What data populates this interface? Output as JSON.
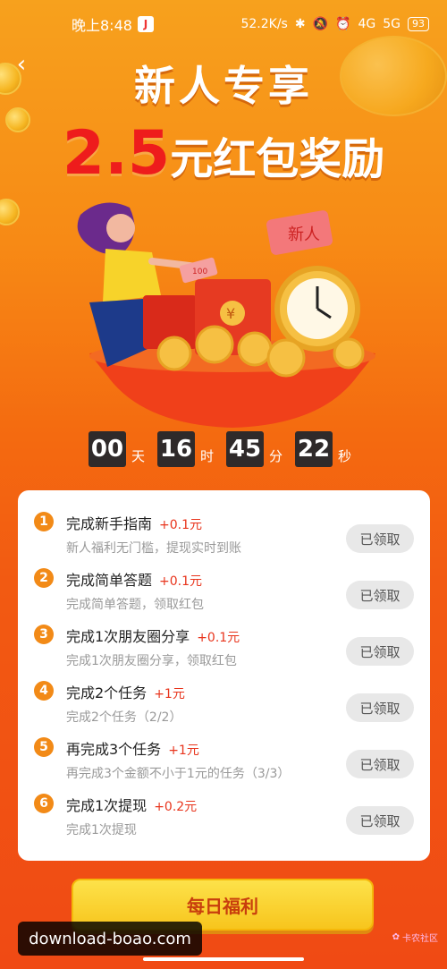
{
  "status_bar": {
    "time": "晚上8:48",
    "app_badge": "J",
    "speed": "52.2K/s",
    "net1": "4G",
    "net2": "5G",
    "battery": "93"
  },
  "hero": {
    "title": "新人专享",
    "amount": "2.5",
    "subtitle": "元红包奖励",
    "illustration_tag": "新人",
    "money_tag": "100",
    "yen_symbol": "¥"
  },
  "countdown": {
    "days": "00",
    "days_unit": "天",
    "hours": "16",
    "hours_unit": "时",
    "minutes": "45",
    "minutes_unit": "分",
    "seconds": "22",
    "seconds_unit": "秒"
  },
  "tasks": [
    {
      "num": "1",
      "title": "完成新手指南",
      "reward": "+0.1元",
      "desc": "新人福利无门槛，提现实时到账",
      "button": "已领取"
    },
    {
      "num": "2",
      "title": "完成简单答题",
      "reward": "+0.1元",
      "desc": "完成简单答题，领取红包",
      "button": "已领取"
    },
    {
      "num": "3",
      "title": "完成1次朋友圈分享",
      "reward": "+0.1元",
      "desc": "完成1次朋友圈分享，领取红包",
      "button": "已领取"
    },
    {
      "num": "4",
      "title": "完成2个任务",
      "reward": "+1元",
      "desc": "完成2个任务（2/2）",
      "button": "已领取"
    },
    {
      "num": "5",
      "title": "再完成3个任务",
      "reward": "+1元",
      "desc": "再完成3个金额不小于1元的任务（3/3）",
      "button": "已领取"
    },
    {
      "num": "6",
      "title": "完成1次提现",
      "reward": "+0.2元",
      "desc": "完成1次提现",
      "button": "已领取"
    }
  ],
  "daily_button": "每日福利",
  "watermark": "download-boao.com",
  "site_badge": "卡农社区",
  "colors": {
    "accent": "#f28a17",
    "reward": "#e8341c",
    "button_bg": "#e8e8e8"
  }
}
